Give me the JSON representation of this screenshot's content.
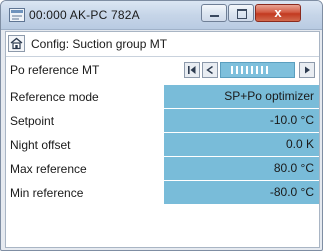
{
  "window": {
    "title": "00:000 AK-PC 782A",
    "controls": {
      "minimize_icon": "minimize-icon",
      "maximize_icon": "maximize-icon",
      "close_glyph": "x"
    }
  },
  "header": {
    "title": "Config: Suction group MT",
    "home_icon": "home-icon"
  },
  "po_reference": {
    "label": "Po reference MT",
    "first_icon": "skip-first-icon",
    "prev_icon": "prev-icon",
    "next_icon": "next-icon"
  },
  "params": [
    {
      "label": "Reference mode",
      "value": "SP+Po optimizer"
    },
    {
      "label": "Setpoint",
      "value": "-10.0 °C"
    },
    {
      "label": "Night offset",
      "value": "0.0 K"
    },
    {
      "label": "Max reference",
      "value": "80.0 °C"
    },
    {
      "label": "Min reference",
      "value": "-80.0 °C"
    }
  ],
  "colors": {
    "value_bg": "#79bcd9",
    "close_button": "#c23a20",
    "titlebar": "#c6d5e8"
  }
}
